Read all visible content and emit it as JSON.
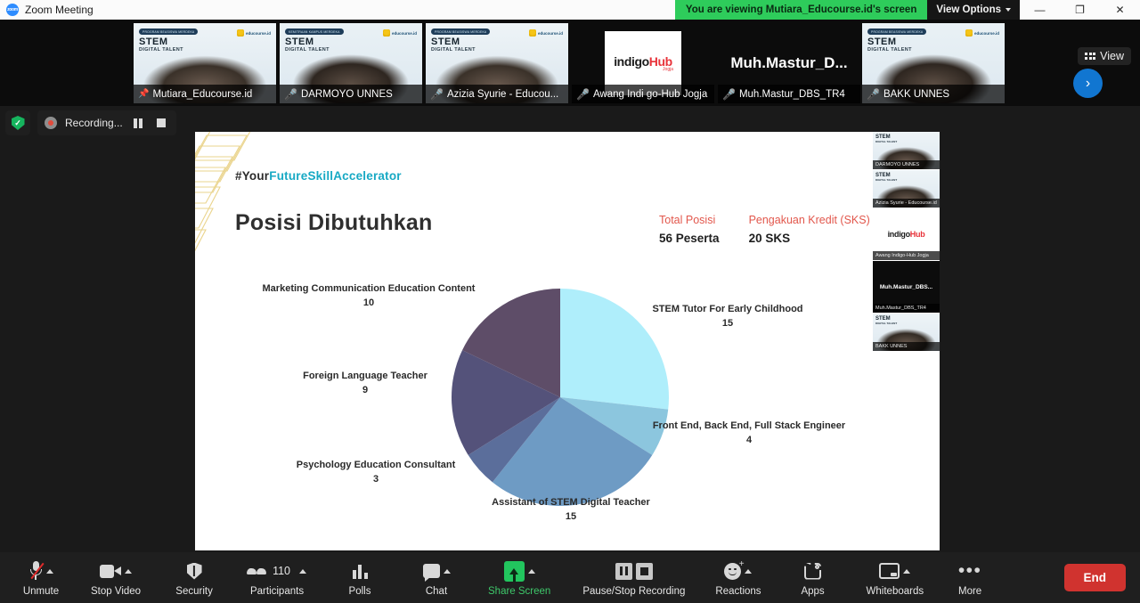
{
  "window": {
    "app_title": "Zoom Meeting",
    "logo_text": "zoom",
    "viewing_banner": "You are viewing Mutiara_Educourse.id's screen",
    "view_options": "View Options",
    "minimize": "—",
    "restore": "❐",
    "close": "✕"
  },
  "filmstrip": {
    "view_button": "View",
    "next_arrow": "›",
    "thumbnails": [
      {
        "name": "Mutiara_Educourse.id",
        "kind": "video",
        "badge": "pin",
        "active": true,
        "stem_pill": "PROGRAM BEASISWA MERDEKA",
        "stem_title": "STEM",
        "stem_sub": "DIGITAL TALENT",
        "logo": "educourse.id"
      },
      {
        "name": "DARMOYO UNNES",
        "kind": "video",
        "badge": "muted",
        "active": false,
        "stem_pill": "KEMITRAAN KAMPUS MERDEKA",
        "stem_title": "STEM",
        "stem_sub": "DIGITAL TALENT",
        "logo": "educourse.id"
      },
      {
        "name": "Azizia Syurie - Educou...",
        "kind": "video",
        "badge": "muted",
        "active": false,
        "stem_pill": "PROGRAM BEASISWA MERDEKA",
        "stem_title": "STEM",
        "stem_sub": "DIGITAL TALENT",
        "logo": "educourse.id"
      },
      {
        "name": "Awang Indi go-Hub Jogja",
        "kind": "logo",
        "badge": "muted",
        "active": false,
        "logo_main": "indigo",
        "logo_accent": "Hub",
        "logo_sub": "Jogja"
      },
      {
        "name": "Muh.Mastur_DBS_TR4",
        "kind": "name",
        "badge": "muted",
        "active": false,
        "card_text": "Muh.Mastur_D..."
      },
      {
        "name": "BAKK UNNES",
        "kind": "video",
        "badge": "muted",
        "active": false,
        "stem_pill": "PROGRAM BEASISWA MERDEKA",
        "stem_title": "STEM",
        "stem_sub": "DIGITAL TALENT",
        "logo": "educourse.id"
      }
    ]
  },
  "recording": {
    "label": "Recording...",
    "pause_title": "Pause Recording",
    "stop_title": "Stop Recording",
    "security_badge": "✓"
  },
  "slide": {
    "hashtag_prefix": "#Your",
    "hashtag_accent": "FutureSkillAccelerator",
    "title": "Posisi Dibutuhkan",
    "stats": [
      {
        "key": "Total Posisi",
        "value": "56 Peserta"
      },
      {
        "key": "Pengakuan Kredit (SKS)",
        "value": "20 SKS"
      }
    ]
  },
  "chart_data": {
    "type": "pie",
    "title": "Posisi Dibutuhkan",
    "total": 56,
    "legend_position": "labels-outside",
    "categories": [
      "STEM Tutor For Early Childhood",
      "Front End, Back End, Full Stack Engineer",
      "Assistant of STEM Digital Teacher",
      "Psychology Education Consultant",
      "Foreign Language Teacher",
      "Marketing Communication Education Content"
    ],
    "values": [
      15,
      4,
      15,
      3,
      9,
      10
    ],
    "colors": [
      "#AFEEFB",
      "#8CC6DE",
      "#6E9BC4",
      "#5B6E9B",
      "#54527A",
      "#5E4D68"
    ],
    "labels": [
      {
        "name": "STEM Tutor For Early Childhood",
        "value": "15"
      },
      {
        "name": "Front End, Back End, Full Stack Engineer",
        "value": "4"
      },
      {
        "name": "Assistant of STEM Digital Teacher",
        "value": "15"
      },
      {
        "name": "Psychology Education Consultant",
        "value": "3"
      },
      {
        "name": "Foreign Language Teacher",
        "value": "9"
      },
      {
        "name": "Marketing Communication Education Content",
        "value": "10"
      }
    ]
  },
  "sidestrip": {
    "cells": [
      {
        "name": "DARMOYO UNNES",
        "kind": "video"
      },
      {
        "name": "Azizia Syurie - Educourse.id",
        "kind": "video"
      },
      {
        "name": "Awang Indigo-Hub Jogja",
        "kind": "logo",
        "logo_main": "indigo",
        "logo_accent": "Hub"
      },
      {
        "name": "Muh.Mastur_DBS_TR4",
        "kind": "name",
        "card_text": "Muh.Mastur_DBS..."
      },
      {
        "name": "BAKK UNNES",
        "kind": "video"
      }
    ]
  },
  "toolbar": {
    "unmute": "Unmute",
    "stop_video": "Stop Video",
    "security": "Security",
    "participants": "Participants",
    "participants_count": "110",
    "polls": "Polls",
    "chat": "Chat",
    "share_screen": "Share Screen",
    "pause_stop_recording": "Pause/Stop Recording",
    "reactions": "Reactions",
    "apps": "Apps",
    "whiteboards": "Whiteboards",
    "more": "More",
    "end": "End"
  },
  "theme": {
    "accent_green": "#2ecc5b",
    "accent_red": "#d0332f",
    "share_green": "#3ec86a",
    "stat_red": "#e2574c",
    "hashtag_cyan": "#17a9c4"
  }
}
